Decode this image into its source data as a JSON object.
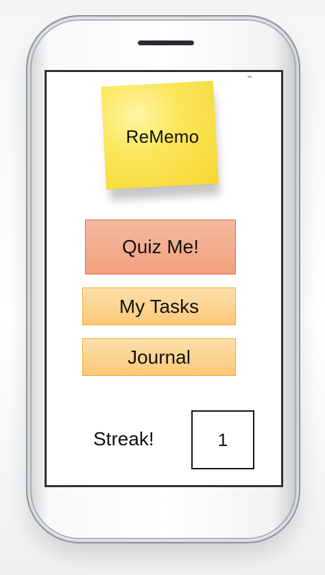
{
  "app": {
    "title": "ReMemo"
  },
  "menu": {
    "quiz_label": "Quiz Me!",
    "tasks_label": "My Tasks",
    "journal_label": "Journal"
  },
  "streak": {
    "label": "Streak!",
    "count": "1"
  },
  "colors": {
    "sticky_note": "#f9de47",
    "quiz_button": "#f4ab8a",
    "quiz_border": "#e06a3b",
    "secondary_button": "#fcd591",
    "secondary_border": "#f0a92a",
    "screen_bezel": "#2e3033"
  },
  "icons": {
    "logo": "sticky-note-icon"
  }
}
